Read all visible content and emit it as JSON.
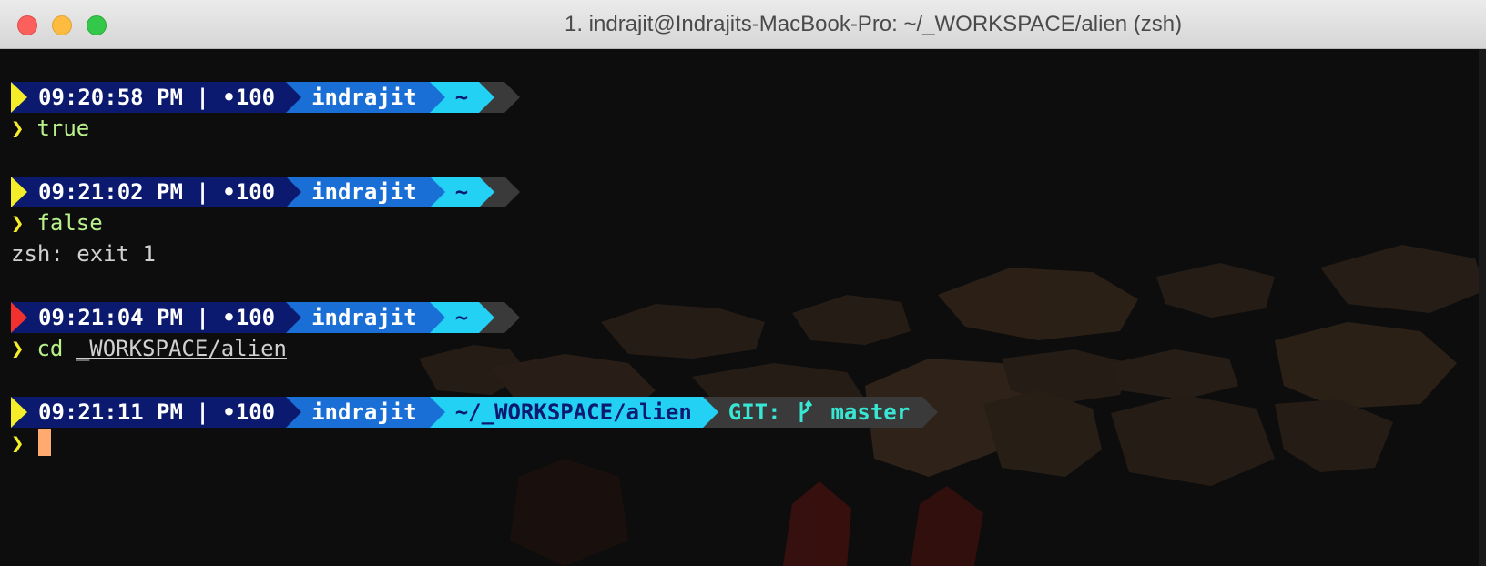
{
  "window": {
    "title": "1. indrajit@Indrajits-MacBook-Pro: ~/_WORKSPACE/alien (zsh)"
  },
  "colors": {
    "status_ok": "#f6ed2a",
    "status_error": "#f0312e",
    "time_bg": "#0b1a6e",
    "user_bg": "#1a6fd6",
    "dir_bg": "#23d1f5",
    "git_bg": "#3a3a3a",
    "git_fg": "#37e7d4",
    "command": "#b8f08a",
    "cursor": "#ffab70"
  },
  "prompt_char": "❯",
  "blocks": [
    {
      "time": "09:20:58 PM | •100",
      "user": "indrajit",
      "dir": "~",
      "command": "true",
      "args": "",
      "output": ""
    },
    {
      "time": "09:21:02 PM | •100",
      "user": "indrajit",
      "dir": "~",
      "command": "false",
      "args": "",
      "output": "zsh: exit 1"
    },
    {
      "time": "09:21:04 PM | •100",
      "user": "indrajit",
      "dir": "~",
      "command": "cd",
      "args": "_WORKSPACE/alien",
      "output": ""
    },
    {
      "time": "09:21:11 PM | •100",
      "user": "indrajit",
      "dir": "~/_WORKSPACE/alien",
      "git_label": "GIT:",
      "git_branch_icon": "branch-icon",
      "git_branch": "master",
      "command": "",
      "args": "",
      "output": ""
    }
  ]
}
